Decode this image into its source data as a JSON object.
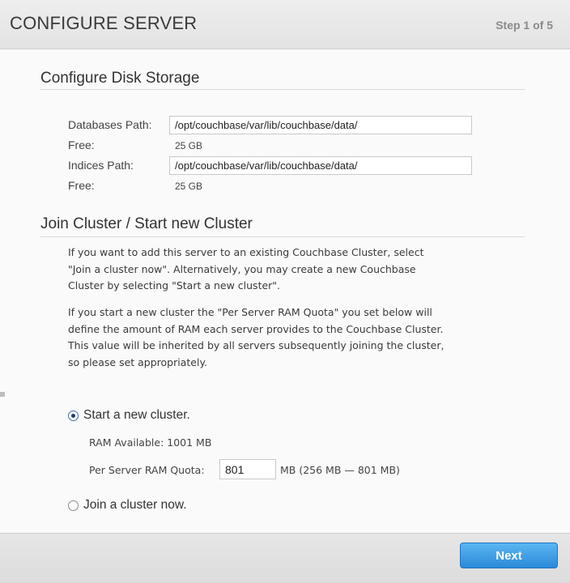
{
  "header": {
    "title": "CONFIGURE SERVER",
    "step": "Step 1 of 5"
  },
  "disk": {
    "title": "Configure Disk Storage",
    "db_path_label": "Databases Path:",
    "db_path_value": "/opt/couchbase/var/lib/couchbase/data/",
    "db_free_label": "Free:",
    "db_free_value": "25 GB",
    "idx_path_label": "Indices Path:",
    "idx_path_value": "/opt/couchbase/var/lib/couchbase/data/",
    "idx_free_label": "Free:",
    "idx_free_value": "25 GB"
  },
  "cluster": {
    "title": "Join Cluster / Start new Cluster",
    "para1_lines": [
      "If you want to add this server to an existing Couchbase Cluster, select",
      "\"Join a cluster now\". Alternatively, you may create a new Couchbase",
      "Cluster by selecting \"Start a new cluster\"."
    ],
    "para2_lines": [
      "If you start a new cluster the \"Per Server RAM Quota\" you set below will",
      "define the amount of RAM each server provides to the Couchbase Cluster.",
      "This value will be inherited by all servers subsequently joining the cluster,",
      "so please set appropriately."
    ],
    "option_new_label": "Start a new cluster.",
    "option_new_checked": true,
    "ram_available": "RAM Available: 1001 MB",
    "quota_label": "Per Server RAM Quota:",
    "quota_value": "801",
    "quota_range": "MB (256 MB — 801 MB)",
    "option_join_label": "Join a cluster now.",
    "option_join_checked": false
  },
  "footer": {
    "next_label": "Next"
  },
  "colors": {
    "accent": "#2b8ad8",
    "radio_selected": "#243b60"
  }
}
